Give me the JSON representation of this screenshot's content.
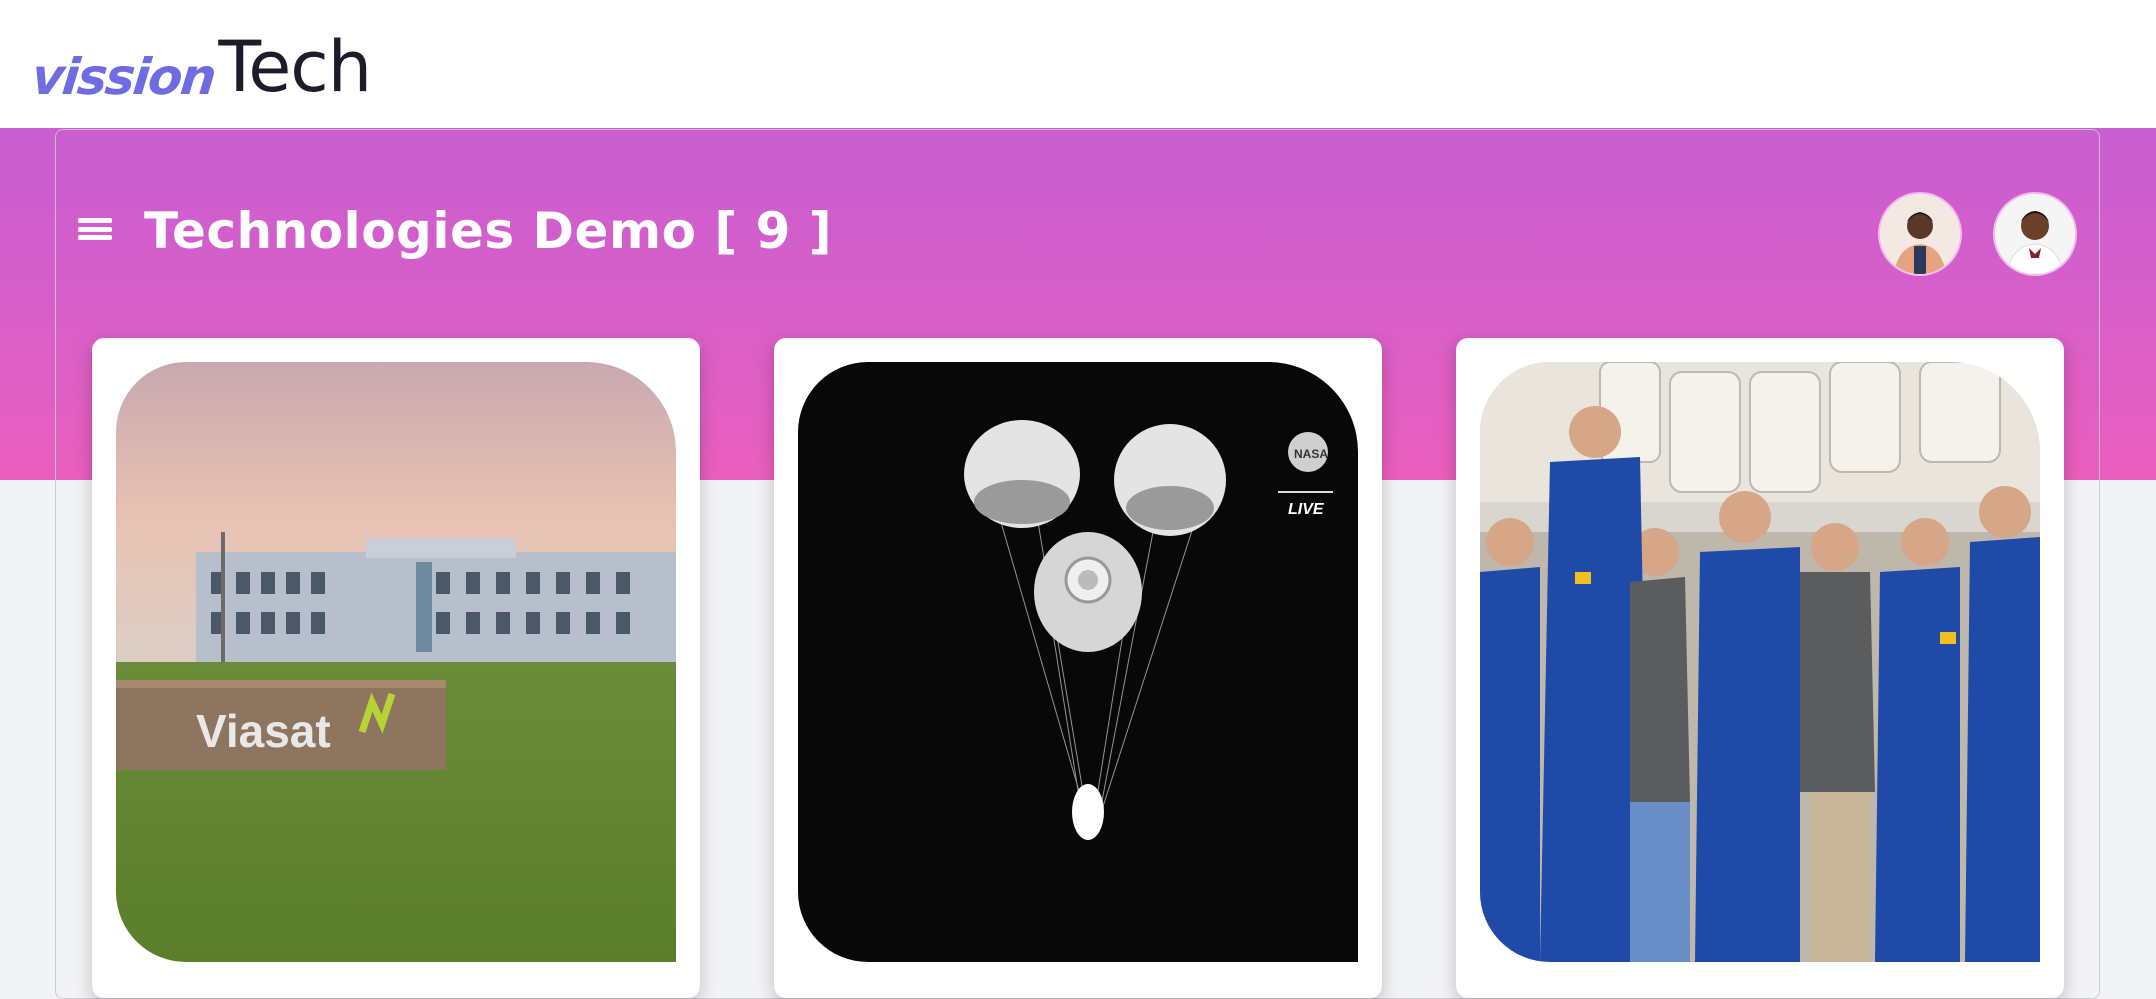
{
  "logo": {
    "part1": "vission",
    "part2": "Tech"
  },
  "header": {
    "menu_icon": "hamburger-menu-icon",
    "title": "Technologies Demo [ 9 ]"
  },
  "avatars": [
    "user-avatar-1",
    "user-avatar-2"
  ],
  "cards": [
    {
      "image": "viasat-building-photo",
      "sign_text": "Viasat"
    },
    {
      "image": "capsule-parachutes-photo",
      "badge": "LIVE",
      "badge_logo": "NASA"
    },
    {
      "image": "astronaut-crew-photo"
    }
  ],
  "colors": {
    "band_top": "#c85ed0",
    "band_bottom": "#ea5fbd",
    "logo_accent": "#6f6be0",
    "logo_dark": "#1c1c2a",
    "background": "#f2f3f5"
  }
}
